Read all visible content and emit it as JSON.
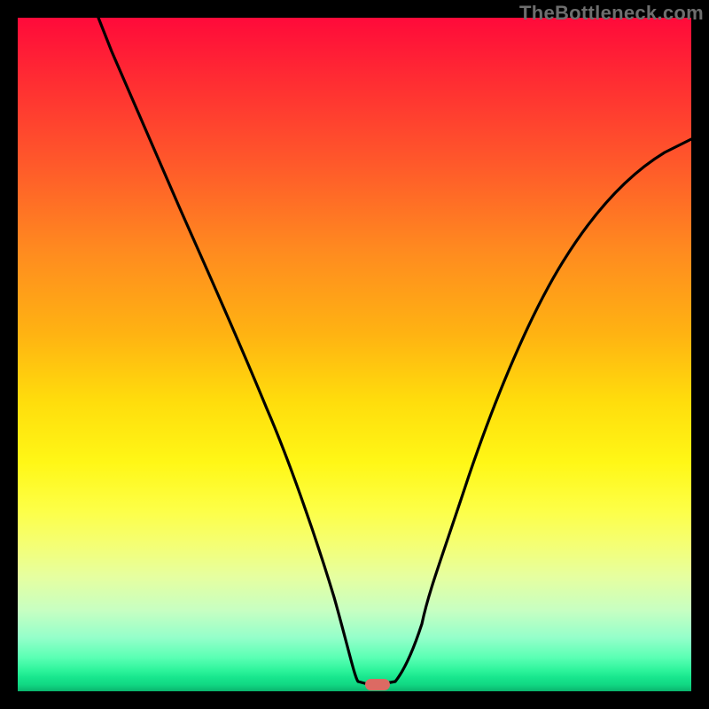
{
  "watermark": "TheBottleneck.com",
  "chart_data": {
    "type": "line",
    "title": "",
    "xlabel": "",
    "ylabel": "",
    "xlim": [
      0,
      100
    ],
    "ylim": [
      0,
      100
    ],
    "grid": false,
    "legend": false,
    "note": "Axes have no visible tick labels; values are estimated percentages of plot width/height.",
    "series": [
      {
        "name": "curve",
        "x": [
          12,
          14,
          17,
          20,
          24,
          28,
          32,
          36,
          40,
          44,
          47,
          49,
          50.5,
          52,
          54,
          56,
          58,
          60,
          63,
          67,
          72,
          77,
          82,
          87,
          92,
          97,
          100
        ],
        "y": [
          100,
          95,
          88,
          81,
          72,
          63,
          54,
          45,
          35,
          24,
          14,
          6,
          1.5,
          1,
          1,
          1.5,
          4,
          10,
          20,
          32,
          44,
          54,
          62,
          69,
          74,
          77,
          79
        ]
      }
    ],
    "marker": {
      "shape": "rounded-rect",
      "x": 53,
      "y": 1,
      "color": "#dc6a63"
    },
    "background_gradient": {
      "top": "#ff0a3a",
      "mid": "#ffe013",
      "bottom": "#09b46c"
    }
  }
}
